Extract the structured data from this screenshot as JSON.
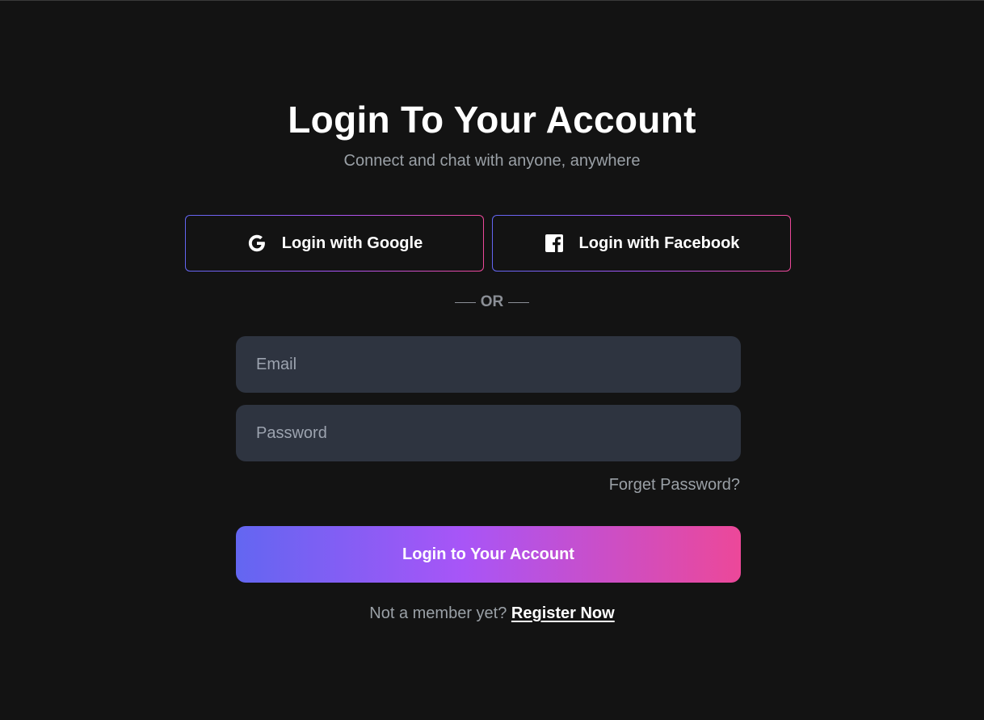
{
  "header": {
    "title": "Login To Your Account",
    "subtitle": "Connect and chat with anyone, anywhere"
  },
  "social": {
    "google": {
      "label": "Login with Google",
      "icon": "google-icon"
    },
    "facebook": {
      "label": "Login with Facebook",
      "icon": "facebook-icon"
    }
  },
  "divider": {
    "text": "OR"
  },
  "form": {
    "email": {
      "value": "",
      "placeholder": "Email"
    },
    "password": {
      "value": "",
      "placeholder": "Password"
    },
    "forgot_label": "Forget Password?",
    "submit_label": "Login to Your Account"
  },
  "footer": {
    "prompt": "Not a member yet?",
    "register_label": "Register Now"
  },
  "colors": {
    "background": "#131313",
    "input_background": "#2e3440",
    "gradient_start": "#6366f1",
    "gradient_mid": "#a855f7",
    "gradient_end": "#ec4899",
    "muted_text": "#9aa0a6"
  }
}
